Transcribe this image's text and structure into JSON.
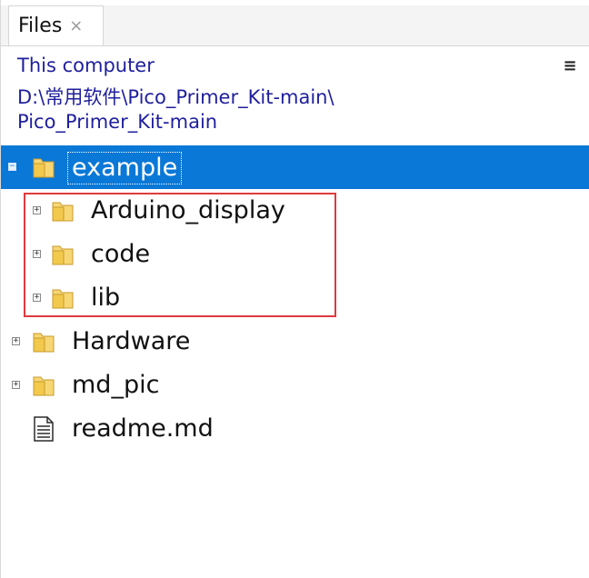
{
  "tab": {
    "label": "Files",
    "close_glyph": "×"
  },
  "path": {
    "line1": "This computer",
    "line2": "D:\\常用软件\\Pico_Primer_Kit-main\\",
    "line3": "Pico_Primer_Kit-main",
    "menu_glyph": "≡"
  },
  "tree": {
    "items": [
      {
        "label": "example",
        "type": "folder",
        "expander": "−",
        "selected": true
      },
      {
        "label": "Arduino_display",
        "type": "folder",
        "expander": "+"
      },
      {
        "label": "code",
        "type": "folder",
        "expander": "+"
      },
      {
        "label": "lib",
        "type": "folder",
        "expander": "+"
      },
      {
        "label": "Hardware",
        "type": "folder",
        "expander": "+"
      },
      {
        "label": "md_pic",
        "type": "folder",
        "expander": "+"
      },
      {
        "label": "readme.md",
        "type": "file"
      }
    ]
  },
  "colors": {
    "selection": "#0a78d7",
    "path_text": "#1f1f9e",
    "highlight_border": "#e03a3e",
    "folder_yellow": "#f2c94c"
  }
}
